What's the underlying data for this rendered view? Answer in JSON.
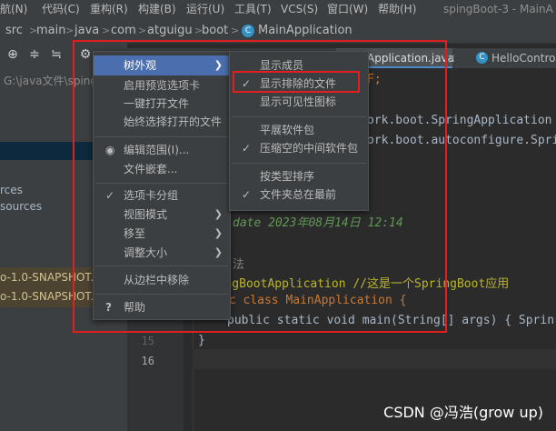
{
  "menubar": {
    "items": [
      "航(N)",
      "代码(C)",
      "重构(R)",
      "构建(B)",
      "运行(U)",
      "工具(T)",
      "VCS(S)",
      "窗口(W)",
      "帮助(H)"
    ],
    "window_title": "spingBoot-3 - MainA"
  },
  "breadcrumb": {
    "items": [
      "src",
      "main",
      "java",
      "com",
      "atguigu",
      "boot",
      "MainApplication"
    ]
  },
  "toolbar": {
    "icons": [
      "crosshair-icon",
      "collapse-icon",
      "expand-icon",
      "gear-icon"
    ]
  },
  "project_panel": {
    "path": "G:\\java文件\\sping",
    "rows": [
      "rces",
      "sources",
      "o-1.0-SNAPSHOT.j",
      "o-1.0-SNAPSHOT.j"
    ]
  },
  "editor": {
    "tabs": [
      "Application.java",
      "HelloContro"
    ],
    "lines": [
      {
        "n": "",
        "text": "F;"
      },
      {
        "n": "",
        "text": "ork.boot.SpringApplication"
      },
      {
        "n": "",
        "text": "ork.boot.autoconfigure.Spri"
      },
      {
        "n": "",
        "text": "date 2023年08月14日 12:14"
      },
      {
        "n": "",
        "text": "法"
      },
      {
        "n": "",
        "text": "pringBootApplication //这是一个SpringBoot应用"
      },
      {
        "n": "",
        "text": "ic class MainApplication {"
      },
      {
        "n": "",
        "text": "public static void main(String[] args) { Sprin"
      },
      {
        "n": "15",
        "text": "}"
      },
      {
        "n": "16",
        "text": ""
      }
    ]
  },
  "context_menu": {
    "items": [
      {
        "label": "树外观",
        "submenu": true,
        "selected": true
      },
      {
        "label": "启用预览选项卡"
      },
      {
        "label": "一键打开文件"
      },
      {
        "label": "始终选择打开的文件"
      },
      {
        "label": "编辑范围(I)...",
        "radio": true
      },
      {
        "label": "文件嵌套..."
      },
      {
        "label": "选项卡分组",
        "checked": true
      },
      {
        "label": "视图模式",
        "submenu": true
      },
      {
        "label": "移至",
        "submenu": true
      },
      {
        "label": "调整大小",
        "submenu": true
      },
      {
        "label": "从边栏中移除"
      },
      {
        "label": "帮助",
        "help": true
      }
    ]
  },
  "submenu": {
    "items": [
      {
        "label": "显示成员"
      },
      {
        "label": "显示排除的文件",
        "checked": true
      },
      {
        "label": "显示可见性图标"
      },
      {
        "label": "平展软件包"
      },
      {
        "label": "压缩空的中间软件包",
        "checked": true
      },
      {
        "label": "按类型排序"
      },
      {
        "label": "文件夹总在最前",
        "checked": true
      }
    ]
  },
  "glyphs": {
    "check": "✓",
    "arrow": "❯",
    "radio": "◉",
    "help": "?"
  },
  "watermark": "CSDN @冯浩(grow up)",
  "colors": {
    "highlight": "#4b6eaf",
    "annotation_box": "#e02020"
  }
}
